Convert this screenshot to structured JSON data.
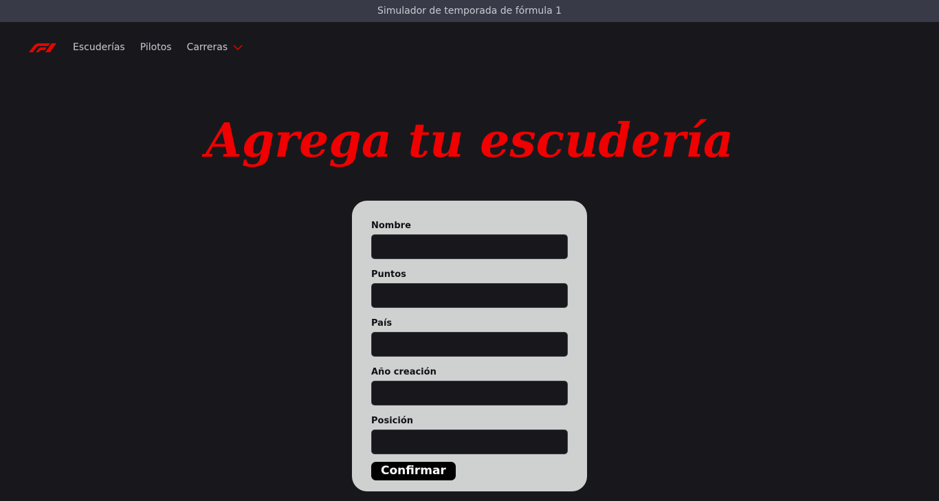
{
  "window": {
    "title": "Simulador de temporada de fórmula 1"
  },
  "nav": {
    "logo_icon": "f1-logo-icon",
    "items": [
      {
        "label": "Escuderías"
      },
      {
        "label": "Pilotos"
      },
      {
        "label": "Carreras",
        "has_dropdown": true
      }
    ]
  },
  "page": {
    "heading": "Agrega tu escudería"
  },
  "form": {
    "fields": [
      {
        "label": "Nombre",
        "value": ""
      },
      {
        "label": "Puntos",
        "value": ""
      },
      {
        "label": "País",
        "value": ""
      },
      {
        "label": "Año creación",
        "value": ""
      },
      {
        "label": "Posición",
        "value": ""
      }
    ],
    "submit_label": "Confirmar"
  },
  "colors": {
    "accent": "#f00000",
    "background": "#18181c",
    "titlebar": "#383a48",
    "card": "#cfd1d0",
    "input_bg": "#17171c"
  }
}
